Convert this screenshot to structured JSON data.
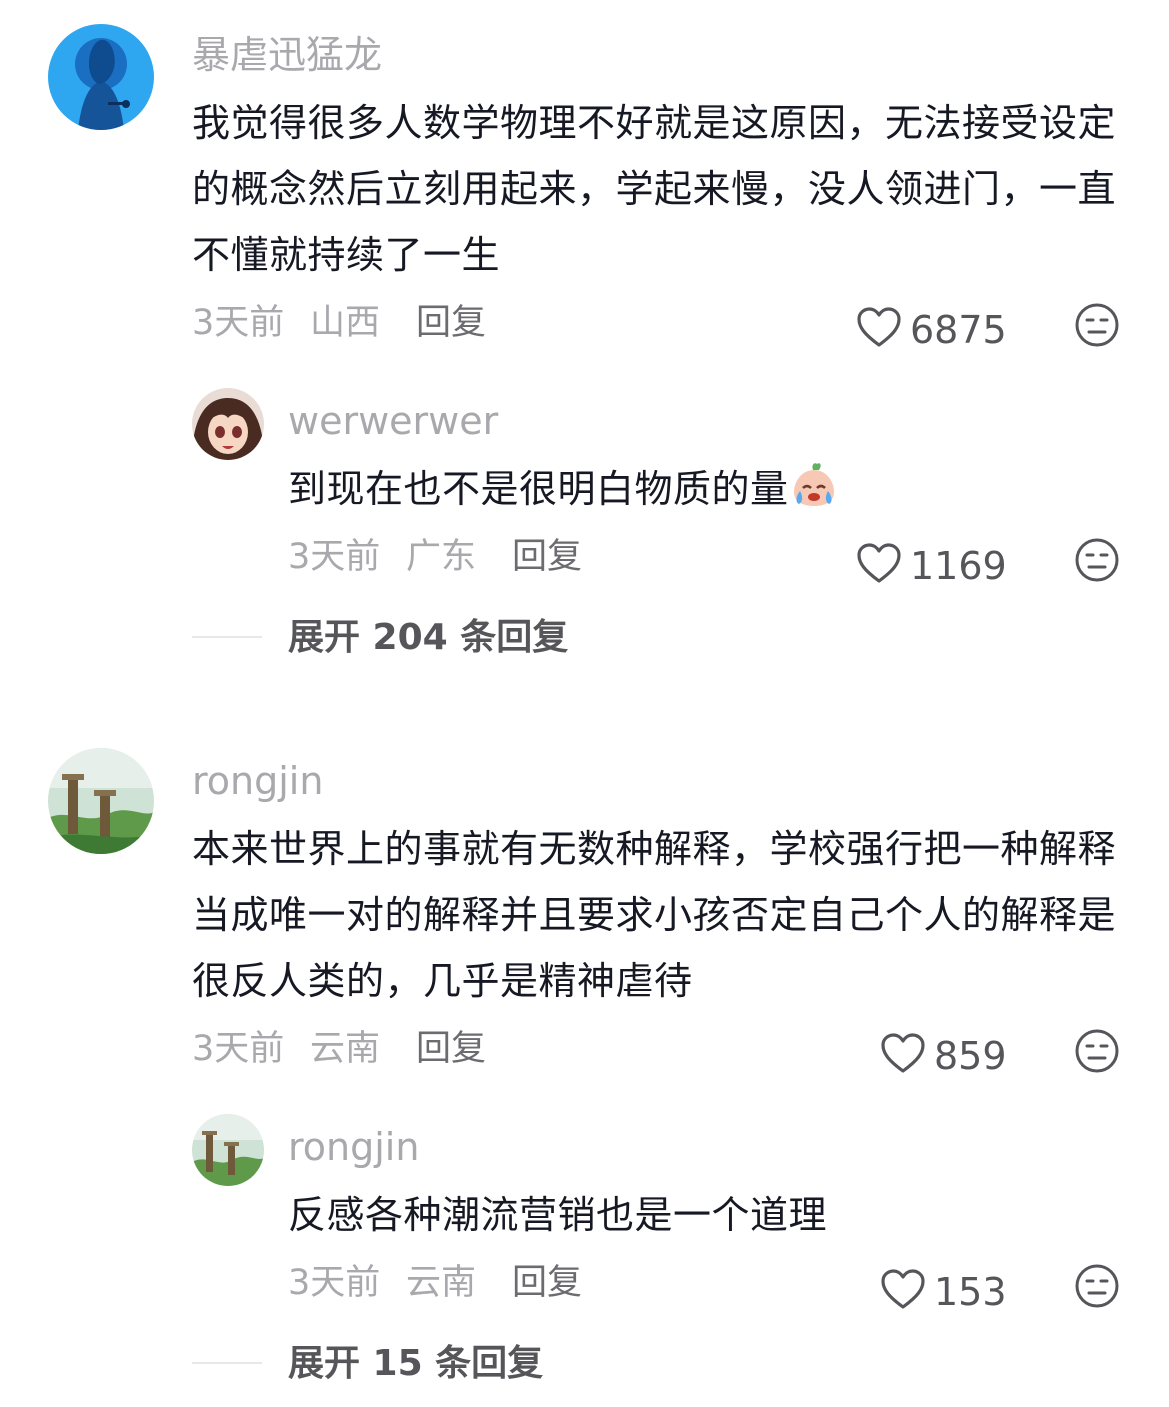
{
  "comments": [
    {
      "username": "暴虐迅猛龙",
      "text": "我觉得很多人数学物理不好就是这原因，无法接受设定的概念然后立刻用起来，学起来慢，没人领进门，一直不懂就持续了一生",
      "time": "3天前",
      "location": "山西",
      "reply_label": "回复",
      "likes": "6875",
      "replies": [
        {
          "username": "werwerwer",
          "text": "到现在也不是很明白物质的量",
          "emoji": "crying-face-emoji",
          "time": "3天前",
          "location": "广东",
          "reply_label": "回复",
          "likes": "1169"
        }
      ],
      "expand_label": "展开 204 条回复"
    },
    {
      "username": "rongjin",
      "text": "本来世界上的事就有无数种解释，学校强行把一种解释当成唯一对的解释并且要求小孩否定自己个人的解释是很反人类的，几乎是精神虐待",
      "time": "3天前",
      "location": "云南",
      "reply_label": "回复",
      "likes": "859",
      "replies": [
        {
          "username": "rongjin",
          "text": "反感各种潮流营销也是一个道理",
          "time": "3天前",
          "location": "云南",
          "reply_label": "回复",
          "likes": "153"
        }
      ],
      "expand_label": "展开 15 条回复"
    }
  ],
  "icons": {
    "like": "heart-outline-icon",
    "dislike": "meh-face-icon"
  },
  "colors": {
    "text": "#161823",
    "muted": "#a8a8ad",
    "secondary": "#55555a"
  }
}
